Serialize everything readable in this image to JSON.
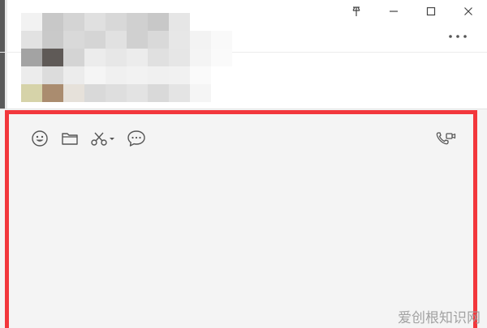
{
  "window": {
    "controls": {
      "pin_icon": "pin-icon",
      "minimize_icon": "minimize-icon",
      "maximize_icon": "maximize-icon",
      "close_icon": "close-icon"
    },
    "more_icon": "more-options-icon"
  },
  "chat_history": {
    "note": "",
    "mosaic_colors": [
      [
        "#f2f2f2",
        "#c8c8c8",
        "#d4d4d4",
        "#e0e0e0",
        "#d8d8d8",
        "#d0d0d0",
        "#c8c8c8",
        "#e6e6e6"
      ],
      [
        "#e2e2e2",
        "#c9c9c9",
        "#d9d9d9",
        "#d5d5d5",
        "#e1e1e1",
        "#d0d0d0",
        "#d9d9d9",
        "#e7e7e7",
        "#f3f3f3",
        "#f9f9f9"
      ],
      [
        "#a3a3a3",
        "#5f5a57",
        "#d4d4d4",
        "#ececec",
        "#e7e7e7",
        "#ececec",
        "#e0e0e0",
        "#e6e6e6",
        "#f4f4f4",
        "#fafafa"
      ],
      [
        "#ececec",
        "#dcdcdc",
        "#ececec",
        "#f5f5f5",
        "#f0f0f0",
        "#f2f2f2",
        "#f0f0f0",
        "#f1f1f1",
        "#fafafa",
        "#ffffff"
      ],
      [
        "#d6d3a9",
        "#aa8c6f",
        "#e6e1da",
        "#d9d9d9",
        "#dedede",
        "#e3e3e3",
        "#d9d9d9",
        "#e4e4e4",
        "#f5f5f5",
        "#ffffff"
      ]
    ]
  },
  "input_toolbar": {
    "emoji_icon": "emoji-icon",
    "folder_icon": "folder-icon",
    "scissors_icon": "screenshot-scissors-icon",
    "chat_icon": "chat-history-icon",
    "call_icon": "voice-video-call-icon"
  },
  "message_input": {
    "value": "",
    "placeholder": ""
  },
  "colors": {
    "highlight": "#f2373c",
    "input_bg": "#f4f4f4"
  },
  "watermark": {
    "text": "爱创根知识网"
  }
}
